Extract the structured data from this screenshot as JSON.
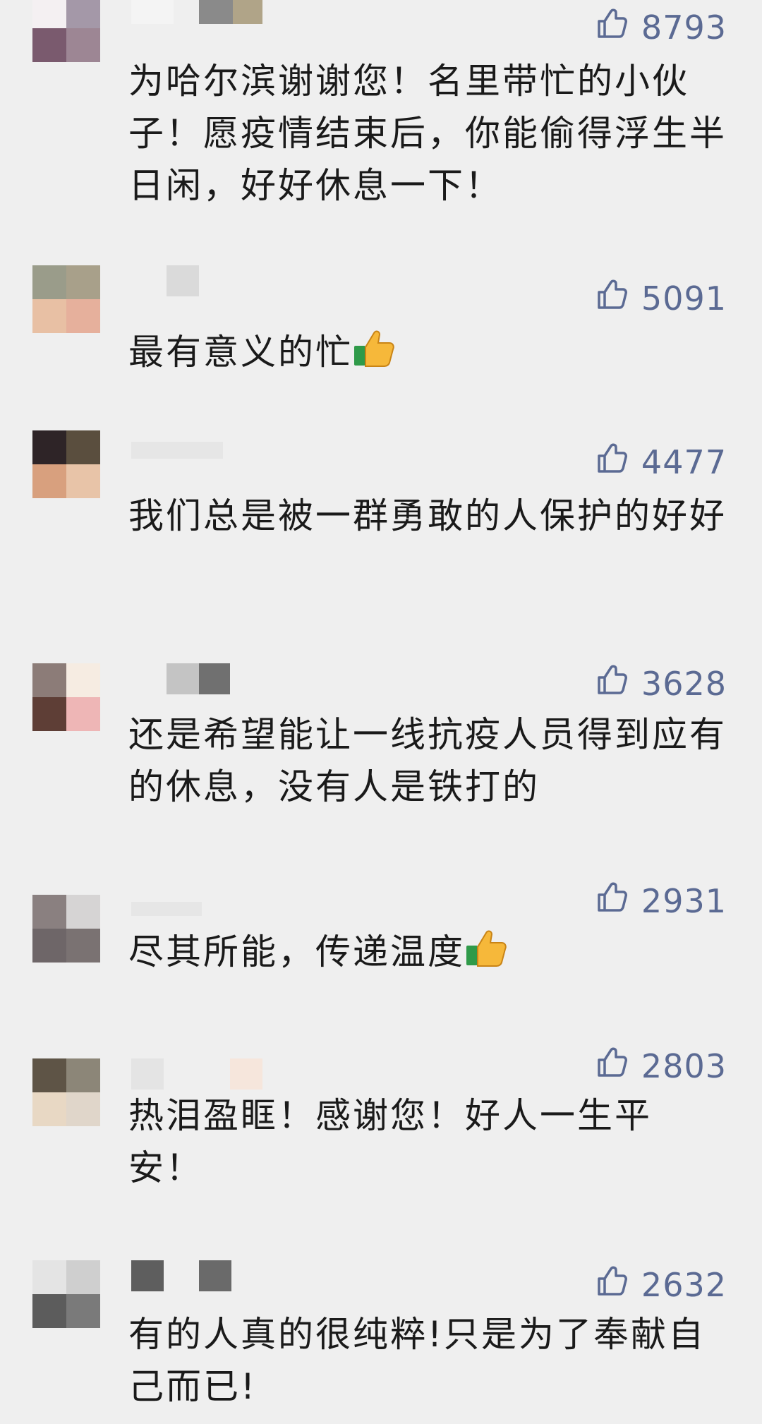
{
  "comments": [
    {
      "likes": "8793",
      "text": "为哈尔滨谢谢您！名里带忙的小伙子！愿疫情结束后，你能偷得浮生半日闲，好好休息一下！",
      "emoji": false
    },
    {
      "likes": "5091",
      "text": "最有意义的忙",
      "emoji": true
    },
    {
      "likes": "4477",
      "text": "我们总是被一群勇敢的人保护的好好",
      "emoji": false
    },
    {
      "likes": "3628",
      "text": "还是希望能让一线抗疫人员得到应有的休息，没有人是铁打的",
      "emoji": false
    },
    {
      "likes": "2931",
      "text": "尽其所能，传递温度",
      "emoji": true
    },
    {
      "likes": "2803",
      "text": "热泪盈眶！感谢您！好人一生平安！",
      "emoji": false
    },
    {
      "likes": "2632",
      "text": "有的人真的很纯粹!只是为了奉献自己而已!",
      "emoji": false
    }
  ],
  "colors": {
    "background": "#efefef",
    "like_color": "#5b6a93",
    "text_color": "#1a1a1a"
  },
  "icons": {
    "like": "thumbs-up-outline-icon",
    "emoji": "thumbs-up-emoji-icon"
  }
}
